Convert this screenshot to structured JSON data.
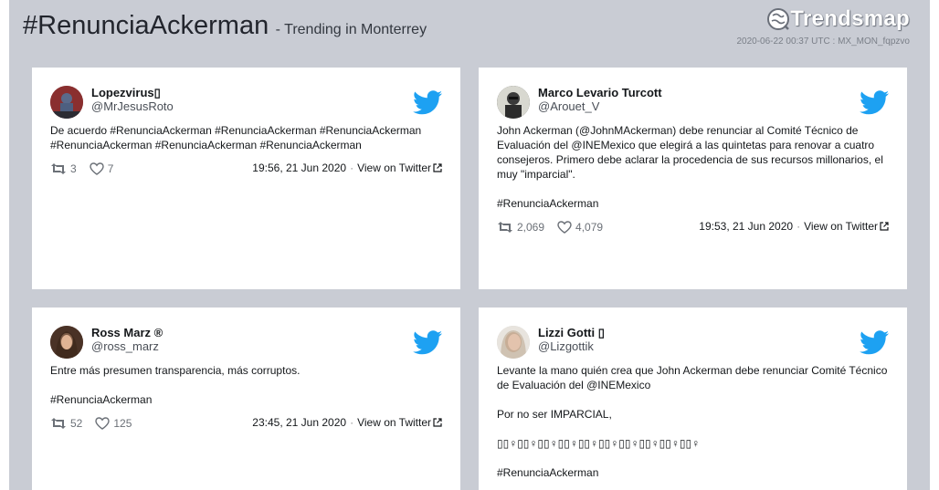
{
  "header": {
    "hashtag": "#RenunciaAckerman",
    "subtitle": "- Trending in Monterrey",
    "logo_text": "Trendsmap",
    "meta": "2020-06-22 00:37 UTC : MX_MON_fqpzvo"
  },
  "view_label": "View on Twitter",
  "colors": {
    "twitter_blue": "#1da1f2",
    "background": "#c9ccd4"
  },
  "tweets": [
    {
      "name": "Lopezvirus▯",
      "handle": "@MrJesusRoto",
      "paragraphs": [
        "De acuerdo #RenunciaAckerman #RenunciaAckerman #RenunciaAckerman #RenunciaAckerman #RenunciaAckerman #RenunciaAckerman"
      ],
      "retweets": "3",
      "likes": "7",
      "time": "19:56, 21 Jun 2020"
    },
    {
      "name": "Marco Levario Turcott",
      "handle": "@Arouet_V",
      "paragraphs": [
        "John Ackerman (@JohnMAckerman) debe renunciar al Comité Técnico de Evaluación del @INEMexico que elegirá a las quintetas para renovar a cuatro consejeros. Primero debe aclarar la procedencia de sus recursos millonarios, el muy \"imparcial\".",
        "#RenunciaAckerman"
      ],
      "retweets": "2,069",
      "likes": "4,079",
      "time": "19:53, 21 Jun 2020"
    },
    {
      "name": "Ross Marz ®",
      "handle": "@ross_marz",
      "paragraphs": [
        "Entre más presumen transparencia, más corruptos.",
        "#RenunciaAckerman"
      ],
      "retweets": "52",
      "likes": "125",
      "time": "23:45, 21 Jun 2020"
    },
    {
      "name": "Lizzi Gotti ▯",
      "handle": "@Lizgottik",
      "paragraphs": [
        "Levante la mano quién crea que John Ackerman debe renunciar Comité Técnico de Evaluación del @INEMexico",
        "Por no ser IMPARCIAL,",
        "▯▯♀▯▯♀▯▯♀▯▯♀▯▯♀▯▯♀▯▯♀▯▯♀▯▯♀▯▯♀",
        "#RenunciaAckerman"
      ]
    }
  ]
}
